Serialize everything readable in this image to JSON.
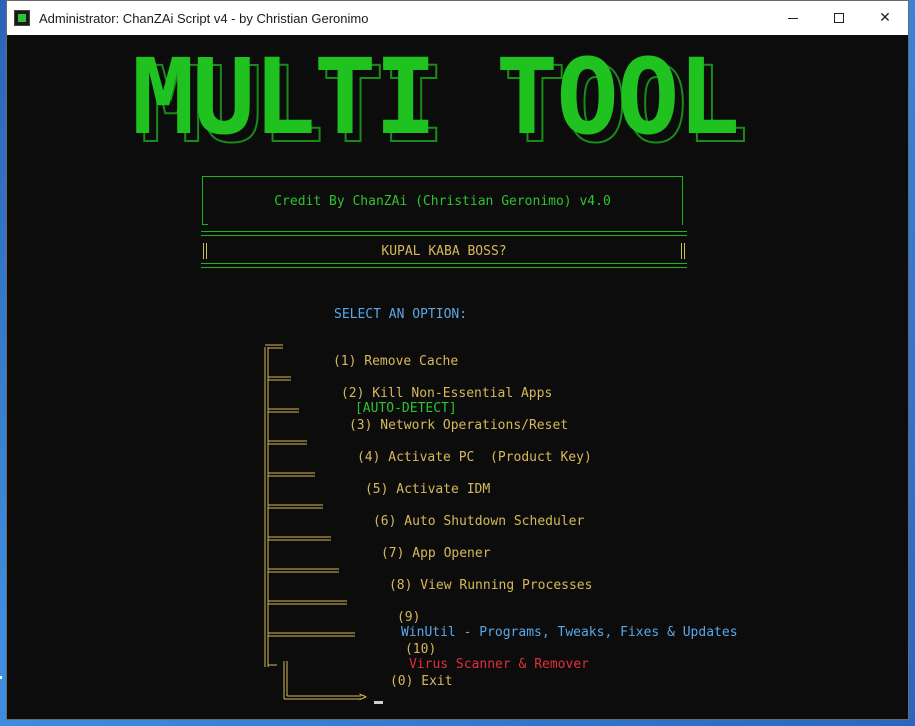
{
  "window": {
    "title": "Administrator:  ChanZAi Script v4 - by Christian Geronimo",
    "controls": {
      "minimize": "",
      "maximize": "",
      "close": "✕"
    }
  },
  "banner": {
    "text": "MULTI TOOL",
    "color": "#1fc21f"
  },
  "credit": {
    "text": "Credit By ChanZAi (Christian Geronimo)  v4.0"
  },
  "subtitle": {
    "text": "KUPAL KABA BOSS?"
  },
  "menu": {
    "heading": "SELECT AN OPTION:",
    "items": [
      {
        "label": "(1) Remove Cache"
      },
      {
        "label": "(2) Kill Non-Essential Apps",
        "tag": "[AUTO-DETECT]"
      },
      {
        "label": "(3) Network Operations/Reset"
      },
      {
        "label": "(4) Activate PC  (Product Key)"
      },
      {
        "label": "(5) Activate IDM"
      },
      {
        "label": "(6) Auto Shutdown Scheduler"
      },
      {
        "label": "(7) App Opener"
      },
      {
        "label": "(8) View Running Processes"
      },
      {
        "number": "(9)",
        "label": "WinUtil - Programs, Tweaks, Fixes & Updates"
      },
      {
        "number": "(10)",
        "label": "Virus Scanner & Remover"
      },
      {
        "label": "(0) Exit"
      }
    ],
    "prompt_arrow": ">"
  },
  "colors": {
    "console_bg": "#0c0c0c",
    "green": "#2fc32f",
    "gold": "#d6b85a",
    "blue": "#5aa7e6",
    "red": "#e0303a"
  }
}
